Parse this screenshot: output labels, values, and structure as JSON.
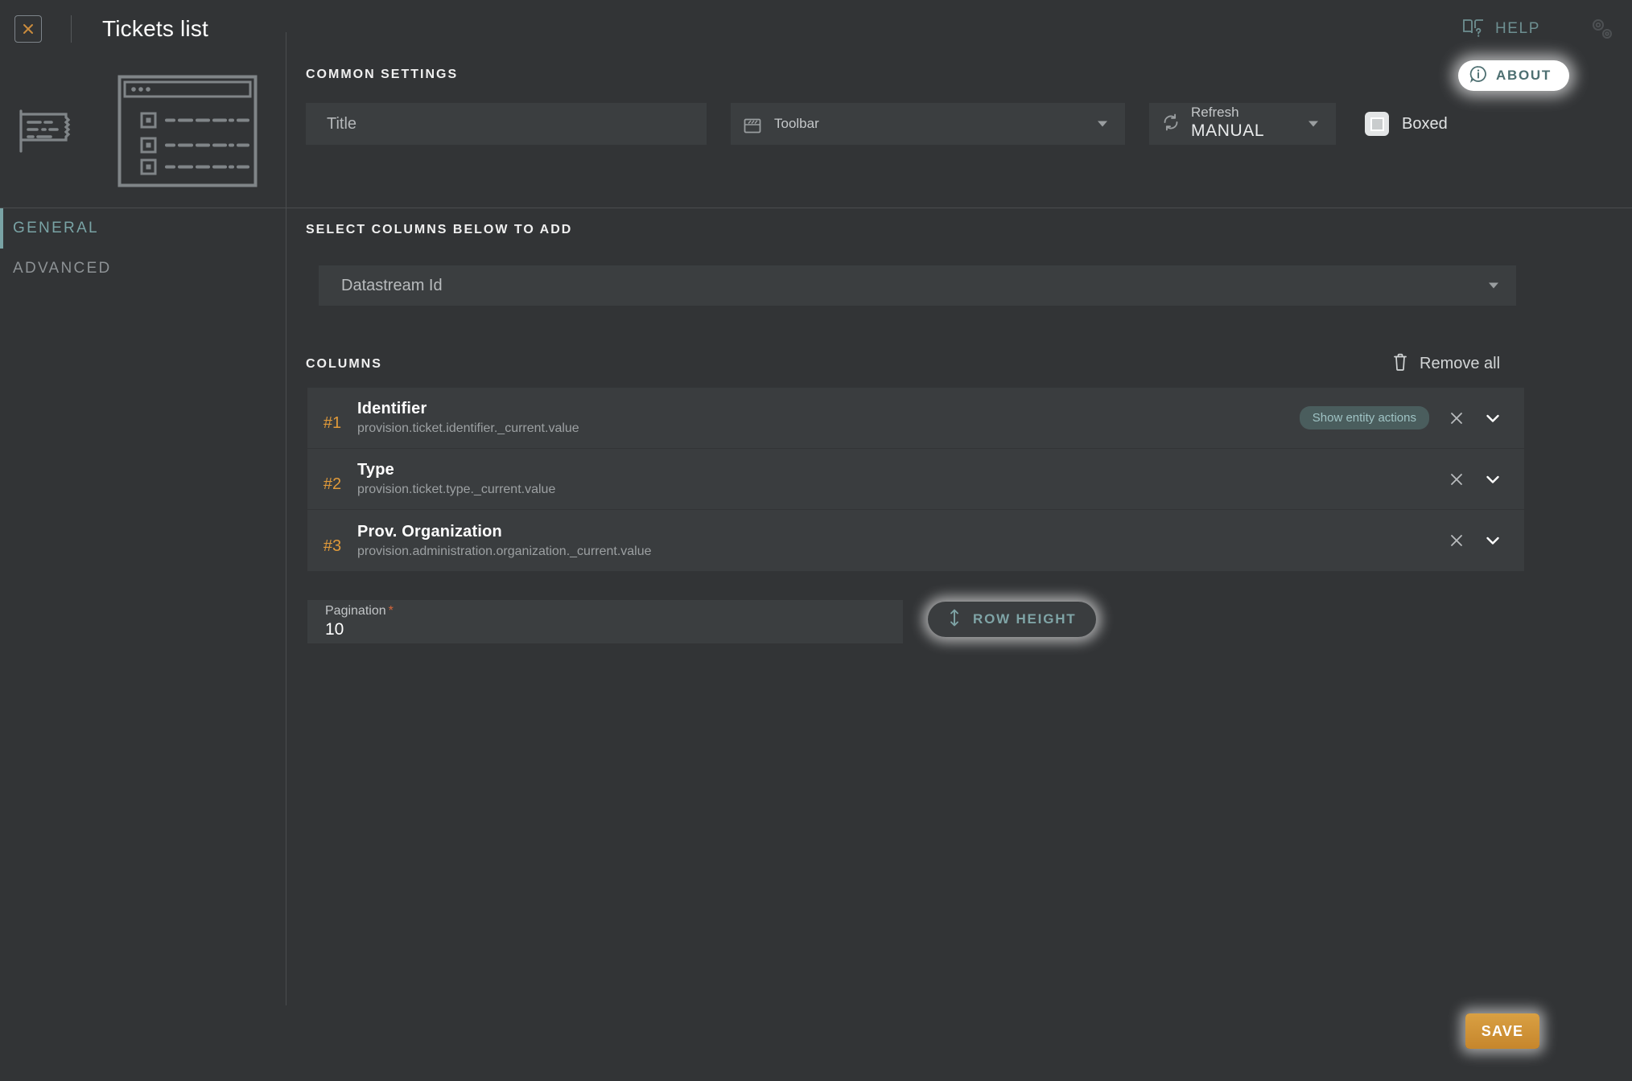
{
  "header": {
    "title": "Tickets list",
    "close_icon": "close-x-icon",
    "help_label": "HELP",
    "help_icon": "book-question-icon",
    "settings_icon": "gears-icon",
    "about_label": "ABOUT",
    "about_icon": "info-circle-icon"
  },
  "preview": {
    "ticket_icon": "ticket-icon",
    "window_icon": "window-list-thumbnail-icon"
  },
  "sidebar": {
    "items": [
      {
        "label": "GENERAL",
        "active": true
      },
      {
        "label": "ADVANCED",
        "active": false
      }
    ]
  },
  "common_settings": {
    "section_label": "COMMON SETTINGS",
    "title_placeholder": "Title",
    "title_value": "",
    "toolbar": {
      "label": "Toolbar",
      "value": "",
      "icon": "toolbar-panel-icon",
      "caret": "chevron-down-icon"
    },
    "refresh": {
      "label": "Refresh",
      "value": "MANUAL",
      "icon": "refresh-icon",
      "caret": "chevron-down-icon",
      "options": [
        "MANUAL"
      ]
    },
    "boxed": {
      "label": "Boxed",
      "checked": true
    }
  },
  "select_columns": {
    "section_label": "SELECT COLUMNS BELOW TO ADD",
    "datastream_value": "Datastream Id",
    "caret": "chevron-down-icon"
  },
  "columns": {
    "section_label": "COLUMNS",
    "remove_all_label": "Remove all",
    "remove_all_icon": "trash-icon",
    "rows": [
      {
        "index": "#1",
        "name": "Identifier",
        "path": "provision.ticket.identifier._current.value",
        "chip": "Show entity actions",
        "remove_icon": "close-x-icon",
        "expand_icon": "chevron-down-icon"
      },
      {
        "index": "#2",
        "name": "Type",
        "path": "provision.ticket.type._current.value",
        "chip": "",
        "remove_icon": "close-x-icon",
        "expand_icon": "chevron-down-icon"
      },
      {
        "index": "#3",
        "name": "Prov. Organization",
        "path": "provision.administration.organization._current.value",
        "chip": "",
        "remove_icon": "close-x-icon",
        "expand_icon": "chevron-down-icon"
      }
    ]
  },
  "pagination": {
    "label": "Pagination",
    "required_marker": "*",
    "value": "10"
  },
  "row_height": {
    "label": "ROW HEIGHT",
    "icon": "vertical-resize-icon"
  },
  "save": {
    "label": "SAVE"
  },
  "colors": {
    "background": "#323436",
    "panel": "#3a3d3f",
    "field": "#3b3e40",
    "accent_teal": "#79a3a5",
    "accent_orange": "#e09a3a",
    "save_orange": "#c6862c",
    "required_red": "#d4653a",
    "text_primary": "#ffffff",
    "text_muted": "#9ca0a2"
  }
}
